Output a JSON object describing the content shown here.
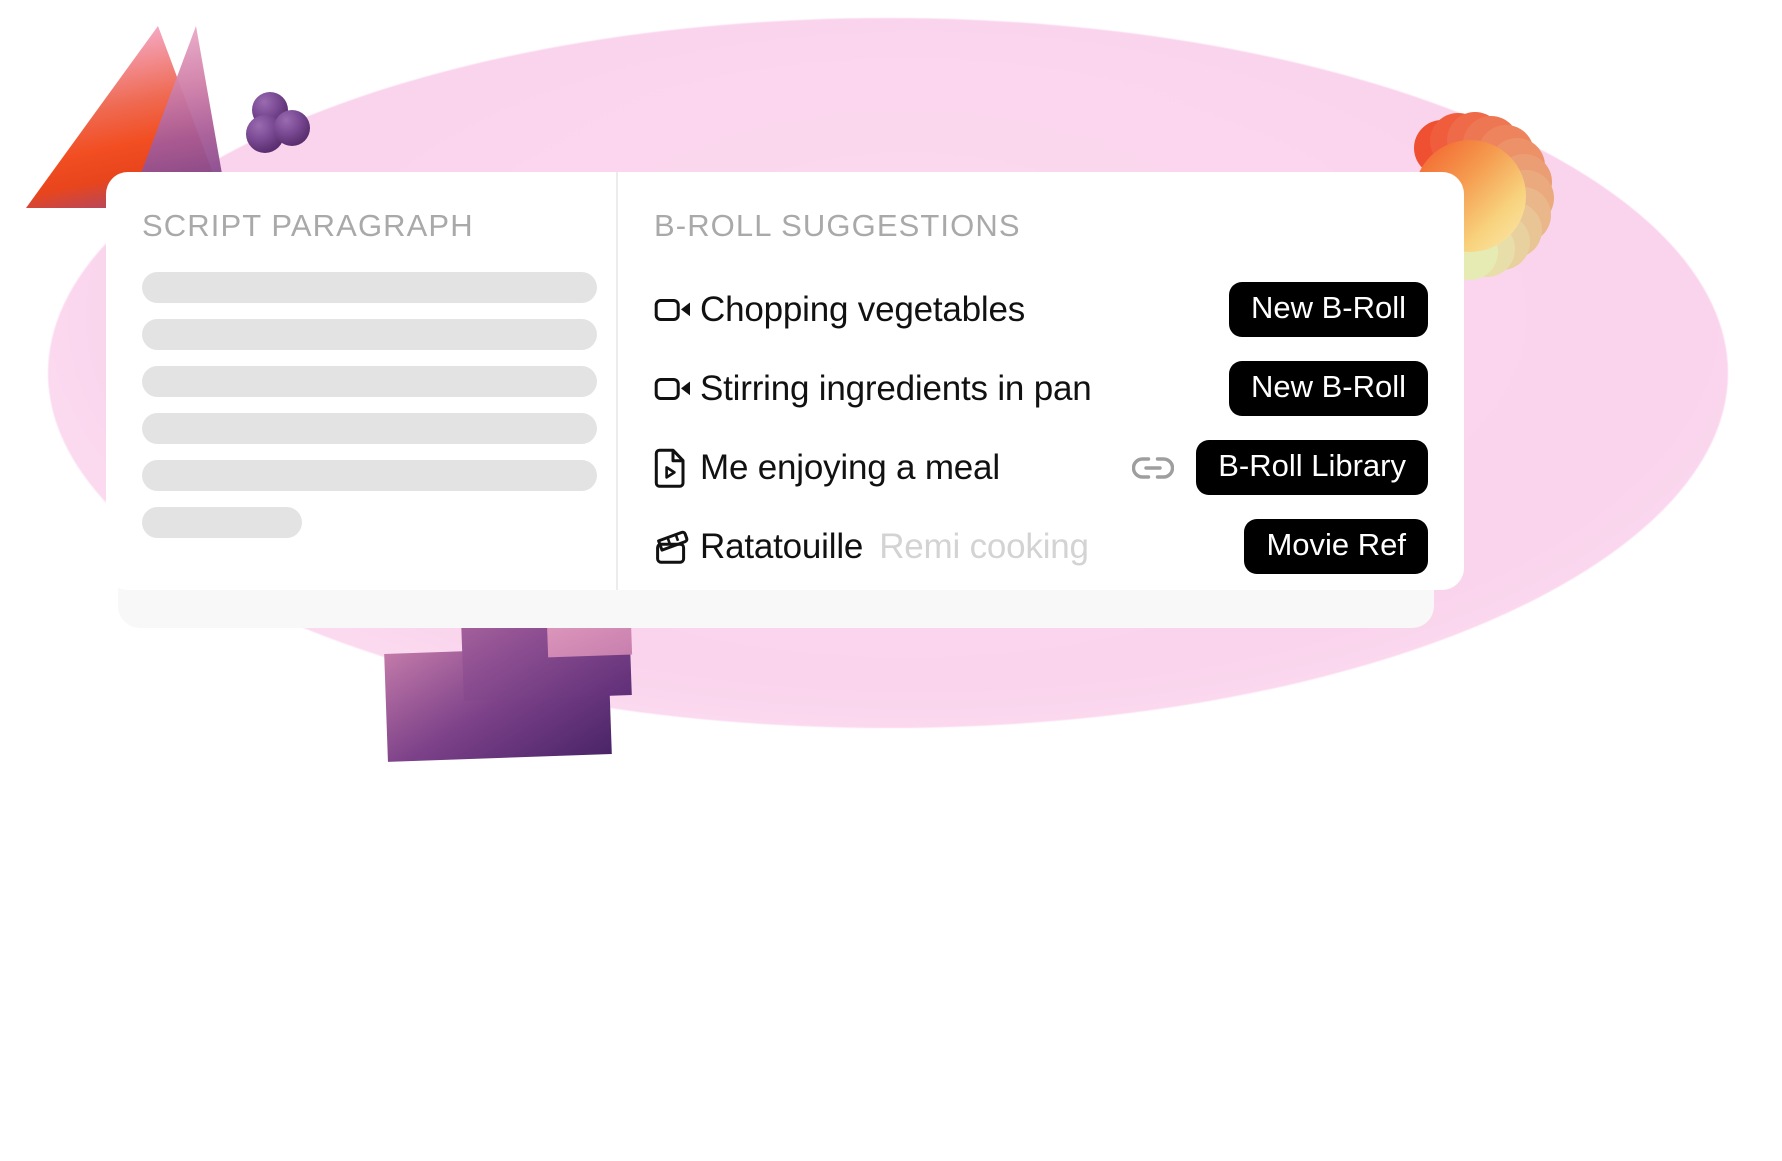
{
  "panels": {
    "script": {
      "title": "SCRIPT PARAGRAPH",
      "skeleton_lines": [
        455,
        455,
        455,
        455,
        455,
        160
      ]
    },
    "broll": {
      "title": "B-ROLL SUGGESTIONS",
      "rows": [
        {
          "icon": "video-camera-icon",
          "label": "Chopping vegetables",
          "sub": "",
          "has_link": false,
          "action": "New B-Roll"
        },
        {
          "icon": "video-camera-icon",
          "label": "Stirring ingredients in pan",
          "sub": "",
          "has_link": false,
          "action": "New B-Roll"
        },
        {
          "icon": "file-play-icon",
          "label": "Me enjoying a meal",
          "sub": "",
          "has_link": true,
          "action": "B-Roll Library"
        },
        {
          "icon": "clapperboard-icon",
          "label": "Ratatouille",
          "sub": "Remi cooking",
          "has_link": false,
          "action": "Movie Ref"
        }
      ]
    }
  },
  "colors": {
    "pill_background": "#000000",
    "pill_text": "#ffffff",
    "panel_title": "#a9a9a9",
    "row_label": "#111111",
    "row_sub": "#d3d3d3",
    "skeleton": "#e3e3e3",
    "blob_pink": "#fbd6ee",
    "card_white": "#ffffff"
  }
}
